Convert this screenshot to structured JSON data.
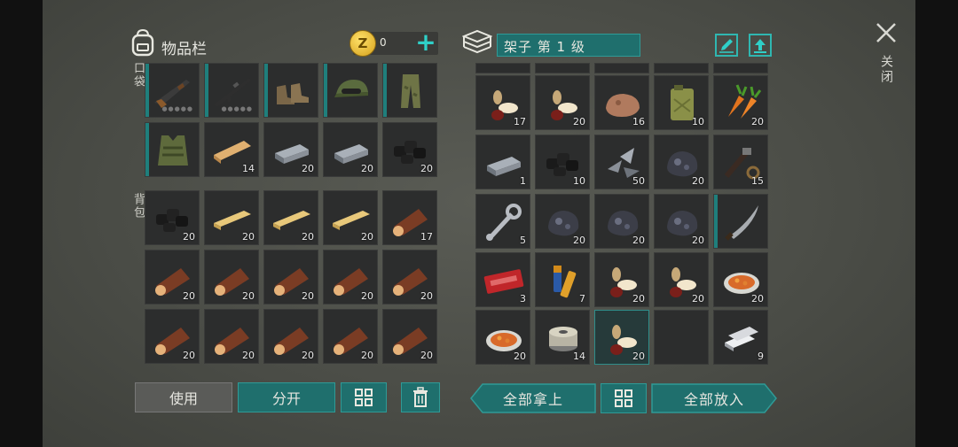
{
  "left_panel": {
    "title": "物品栏",
    "coins": "0",
    "pocket_label": "口袋",
    "backpack_label": "背包",
    "pocket_row1": [
      {
        "icon": "shotgun-icon",
        "count": ""
      },
      {
        "icon": "rifle-icon",
        "count": ""
      },
      {
        "icon": "boots-icon",
        "count": ""
      },
      {
        "icon": "cap-icon",
        "count": ""
      },
      {
        "icon": "pants-icon",
        "count": ""
      }
    ],
    "pocket_row2": [
      {
        "icon": "vest-icon",
        "count": ""
      },
      {
        "icon": "plank-icon",
        "count": "14"
      },
      {
        "icon": "iron-ingot-icon",
        "count": "20"
      },
      {
        "icon": "iron-ingot-icon",
        "count": "20"
      },
      {
        "icon": "coal-icon",
        "count": "20"
      }
    ],
    "backpack_rows": [
      [
        {
          "icon": "coal-icon",
          "count": "20"
        },
        {
          "icon": "board-icon",
          "count": "20"
        },
        {
          "icon": "board-icon",
          "count": "20"
        },
        {
          "icon": "board-icon",
          "count": "20"
        },
        {
          "icon": "log-icon",
          "count": "17"
        }
      ],
      [
        {
          "icon": "log-icon",
          "count": "20"
        },
        {
          "icon": "log-icon",
          "count": "20"
        },
        {
          "icon": "log-icon",
          "count": "20"
        },
        {
          "icon": "log-icon",
          "count": "20"
        },
        {
          "icon": "log-icon",
          "count": "20"
        }
      ],
      [
        {
          "icon": "log-icon",
          "count": "20"
        },
        {
          "icon": "log-icon",
          "count": "20"
        },
        {
          "icon": "log-icon",
          "count": "20"
        },
        {
          "icon": "log-icon",
          "count": "20"
        },
        {
          "icon": "log-icon",
          "count": "20"
        }
      ]
    ],
    "use_button": "使用",
    "split_button": "分开"
  },
  "right_panel": {
    "title": "架子 第 1 级",
    "rows": [
      [
        {
          "icon": "seeds-icon",
          "count": "17"
        },
        {
          "icon": "seeds-icon",
          "count": "20"
        },
        {
          "icon": "ore-icon",
          "count": "16"
        },
        {
          "icon": "jerrycan-icon",
          "count": "10"
        },
        {
          "icon": "carrot-icon",
          "count": "20"
        }
      ],
      [
        {
          "icon": "iron-ingot-icon",
          "count": "1"
        },
        {
          "icon": "coal-icon",
          "count": "10"
        },
        {
          "icon": "scrap-metal-icon",
          "count": "50"
        },
        {
          "icon": "iron-ore-icon",
          "count": "20"
        },
        {
          "icon": "tools-parts-icon",
          "count": "15"
        }
      ],
      [
        {
          "icon": "wrench-icon",
          "count": "5"
        },
        {
          "icon": "iron-ore-icon",
          "count": "20"
        },
        {
          "icon": "iron-ore-icon",
          "count": "20"
        },
        {
          "icon": "iron-ore-icon",
          "count": "20"
        },
        {
          "icon": "machete-icon",
          "count": ""
        }
      ],
      [
        {
          "icon": "coupon-icon",
          "count": "3"
        },
        {
          "icon": "batteries-icon",
          "count": "7"
        },
        {
          "icon": "seeds-icon",
          "count": "20"
        },
        {
          "icon": "seeds-icon",
          "count": "20"
        },
        {
          "icon": "stew-icon",
          "count": "20"
        }
      ],
      [
        {
          "icon": "stew-icon",
          "count": "20"
        },
        {
          "icon": "wire-spool-icon",
          "count": "14"
        },
        {
          "icon": "seeds-icon",
          "count": "20"
        },
        {
          "icon": "",
          "count": ""
        },
        {
          "icon": "silver-ingot-icon",
          "count": "9"
        }
      ]
    ],
    "take_all_button": "全部拿上",
    "put_all_button": "全部放入"
  },
  "close_label": "关闭",
  "colors": {
    "teal": "#1f6f6d",
    "teal_border": "#2f9a96",
    "slot_bg": "#2c2d2d",
    "panel_bg": "#4a4c46"
  }
}
